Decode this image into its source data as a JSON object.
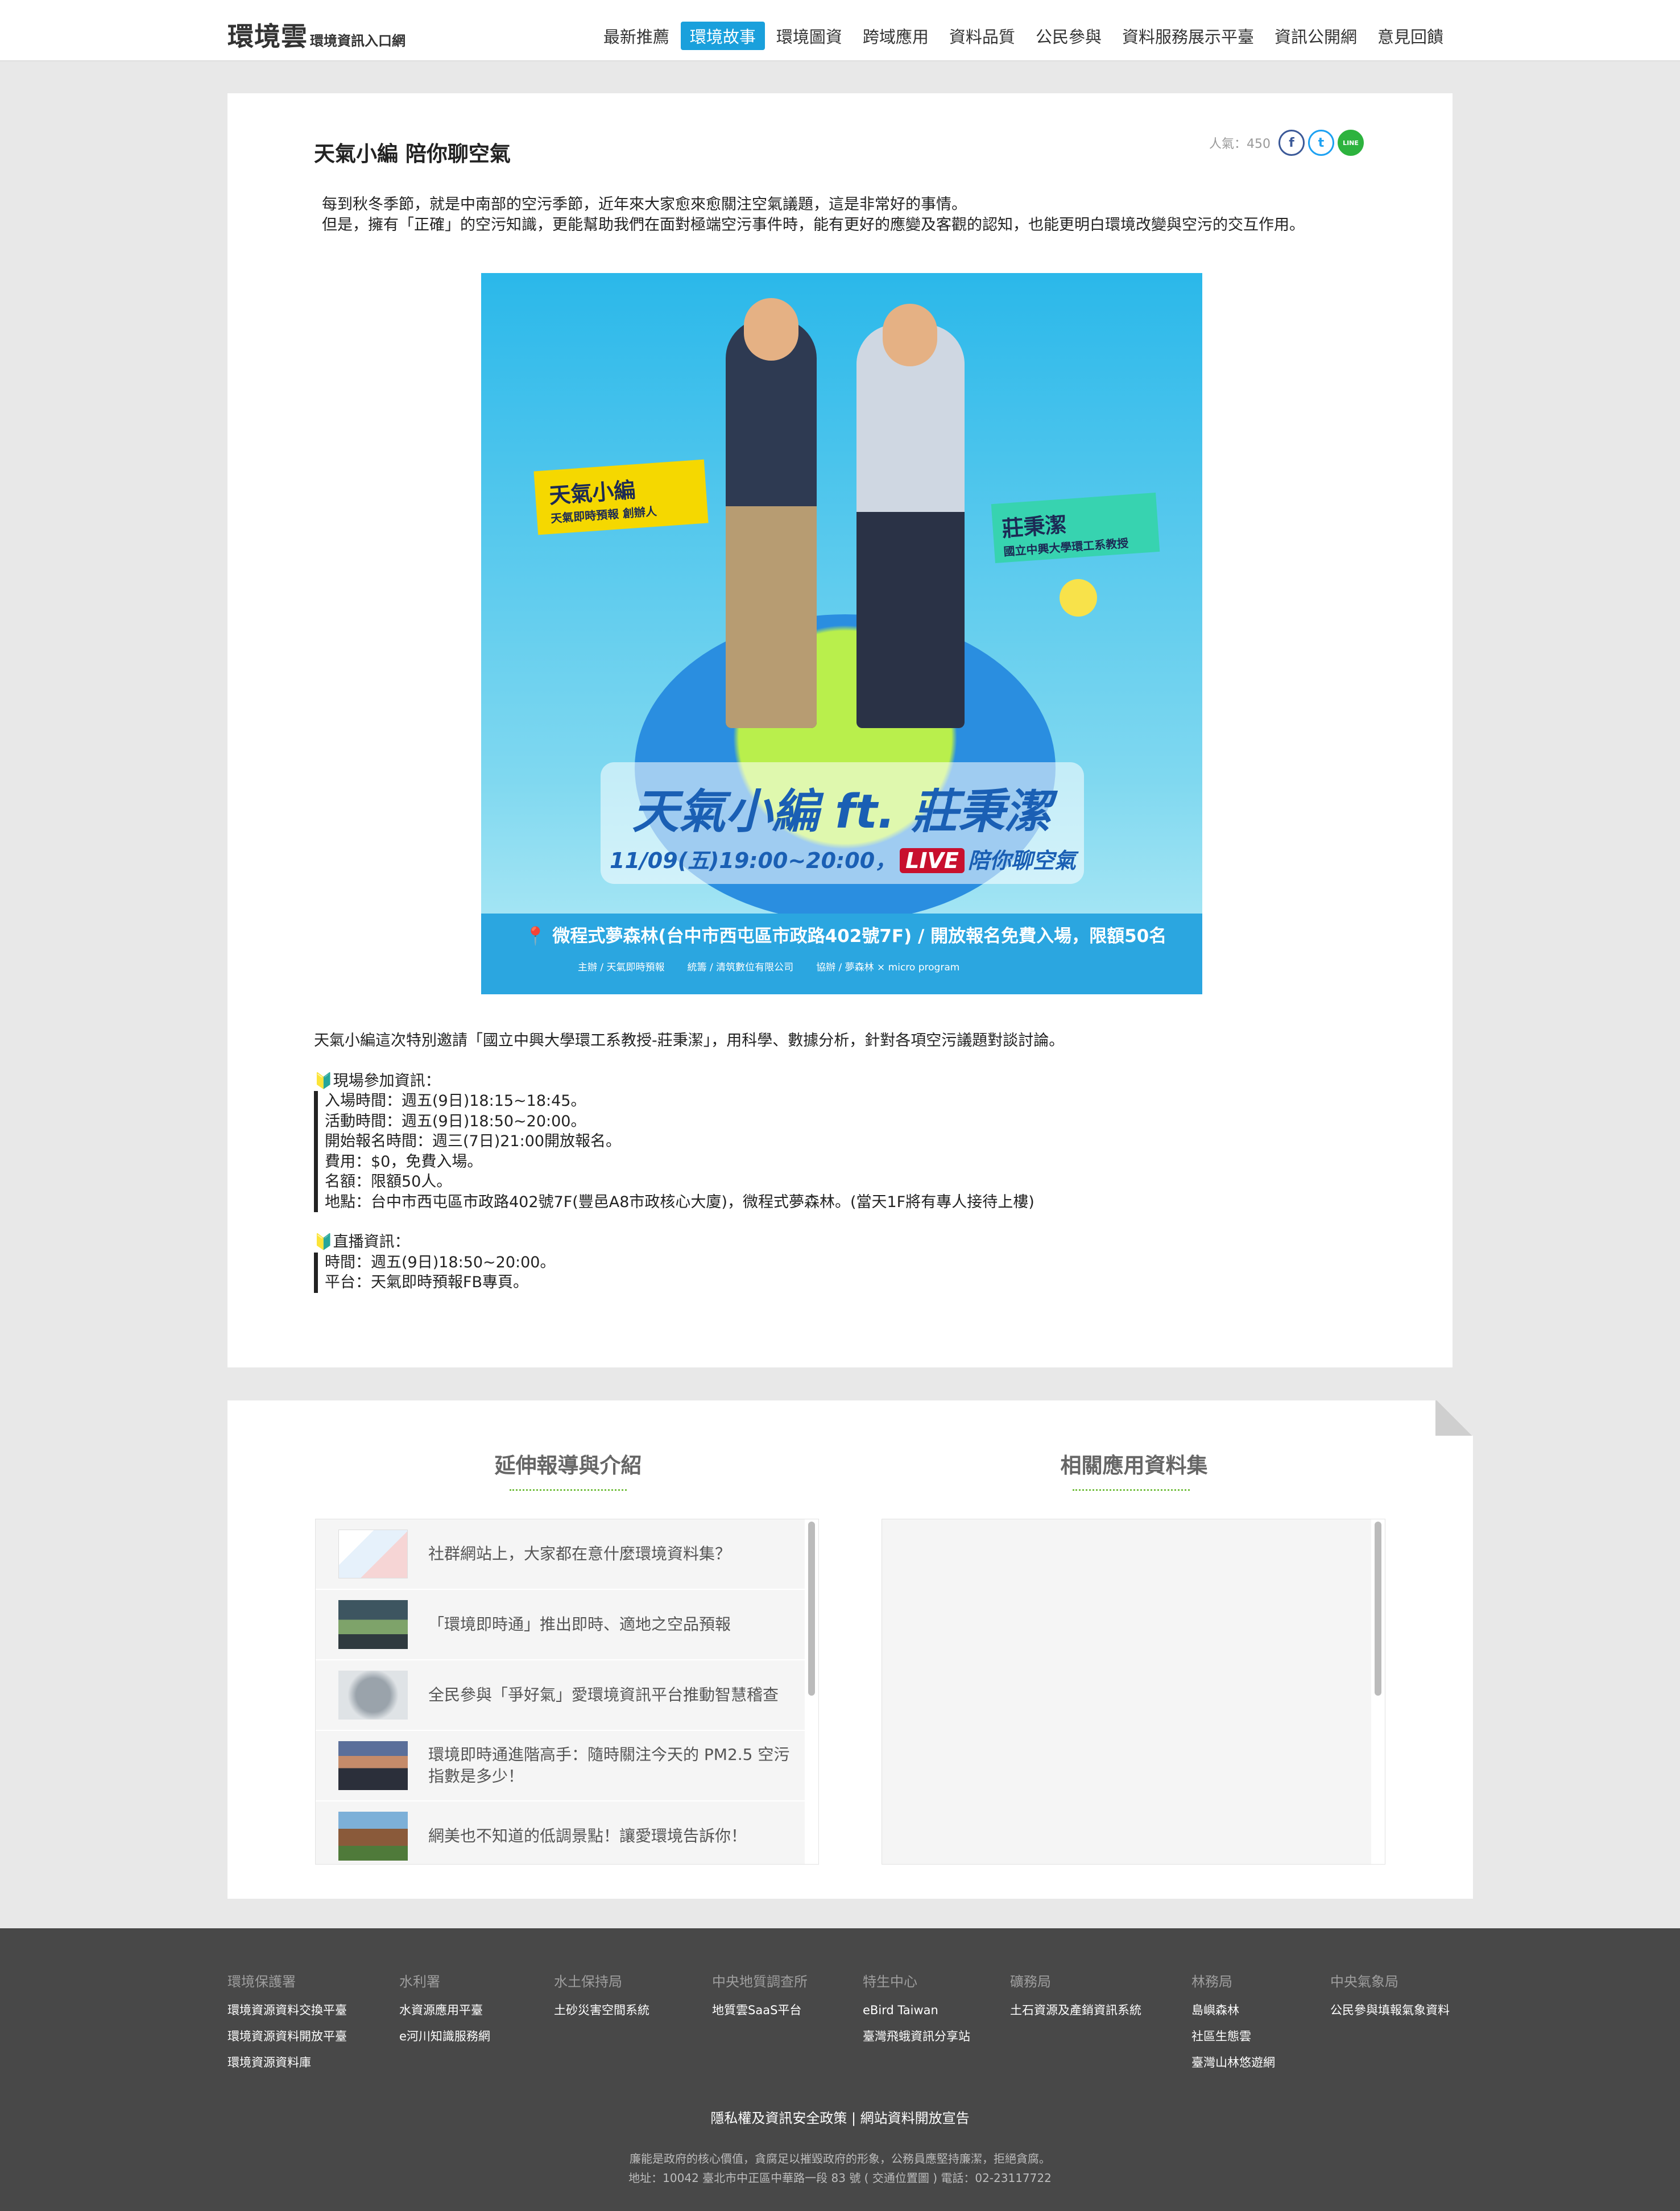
{
  "header": {
    "logo_main": "環境雲",
    "logo_sub": "環境資訊入口網",
    "nav": [
      "最新推薦",
      "環境故事",
      "環境圖資",
      "跨域應用",
      "資料品質",
      "公民參與",
      "資料服務展示平臺",
      "資訊公開網",
      "意見回饋"
    ],
    "active_nav": "環境故事"
  },
  "article": {
    "title": "天氣小編 陪你聊空氣",
    "views_label": "人氣：450",
    "social": {
      "facebook": "f",
      "twitter": "t",
      "line": "LINE"
    },
    "intro": [
      "每到秋冬季節，就是中南部的空污季節，近年來大家愈來愈關注空氣議題，這是非常好的事情。",
      "但是，擁有「正確」的空污知識，更能幫助我們在面對極端空污事件時，能有更好的應變及客觀的認知，也能更明白環境改變與空污的交互作用。"
    ],
    "banner": {
      "tag1_name": "天氣小編",
      "tag1_role": "天氣即時預報 創辦人",
      "tag2_name": "莊秉潔",
      "tag2_role": "國立中興大學環工系教授",
      "title": "天氣小編 ft. 莊秉潔",
      "date": "11/09(五)19:00~20:00，",
      "live": "LIVE",
      "date_tail": "陪你聊空氣",
      "venue": "微程式夢森林(台中市西屯區市政路402號7F)  /  開放報名免費入場，限額50名",
      "sponsor1": "主辦 / 天氣即時預報",
      "sponsor2": "統籌 / 清筑數位有限公司",
      "sponsor3": "協辦 / 夢森林 × micro program"
    },
    "body_lead": "天氣小編這次特別邀請「國立中興大學環工系教授-莊秉潔」，用科學、數據分析，針對各項空污議題對談討論。",
    "onsite_title": "🔰現場參加資訊：",
    "onsite": [
      "入場時間：週五(9日)18:15~18:45。",
      "活動時間：週五(9日)18:50~20:00。",
      "開始報名時間：週三(7日)21:00開放報名。",
      "費用：$0，免費入場。",
      "名額：限額50人。",
      "地點：台中市西屯區市政路402號7F(豐邑A8市政核心大廈)，微程式夢森林。(當天1F將有專人接待上樓)"
    ],
    "live_title": "🔰直播資訊：",
    "live_items": [
      "時間：週五(9日)18:50~20:00。",
      "平台：天氣即時預報FB專頁。"
    ]
  },
  "related": {
    "left_title": "延伸報導與介紹",
    "right_title": "相關應用資料集",
    "items": [
      "社群網站上，大家都在意什麼環境資料集？",
      "「環境即時通」推出即時、適地之空品預報",
      "全民參與「爭好氣」愛環境資訊平台推動智慧稽查",
      "環境即時通進階高手：隨時關注今天的 PM2.5 空污指數是多少！",
      "網美也不知道的低調景點！讓愛環境告訴你！"
    ]
  },
  "footer": {
    "columns": [
      {
        "head": "環境保護署",
        "links": [
          "環境資源資料交換平臺",
          "環境資源資料開放平臺",
          "環境資源資料庫"
        ]
      },
      {
        "head": "水利署",
        "links": [
          "水資源應用平臺",
          "e河川知識服務網"
        ]
      },
      {
        "head": "水土保持局",
        "links": [
          "土砂災害空間系統"
        ]
      },
      {
        "head": "中央地質調查所",
        "links": [
          "地質雲SaaS平台"
        ]
      },
      {
        "head": "特生中心",
        "links": [
          "eBird Taiwan",
          "臺灣飛蛾資訊分享站"
        ]
      },
      {
        "head": "礦務局",
        "links": [
          "土石資源及產銷資訊系統"
        ]
      },
      {
        "head": "林務局",
        "links": [
          "島嶼森林",
          "社區生態雲",
          "臺灣山林悠遊網"
        ]
      },
      {
        "head": "中央氣象局",
        "links": [
          "公民參與填報氣象資料"
        ]
      }
    ],
    "policy": "隱私權及資訊安全政策  |  網站資料開放宣告",
    "note1": "廉能是政府的核心價值，貪腐足以摧毀政府的形象，公務員應堅持廉潔，拒絕貪腐。",
    "note2": "地址：10042 臺北市中正區中華路一段 83 號 ( 交通位置圖 )   電話：02-23117722"
  }
}
